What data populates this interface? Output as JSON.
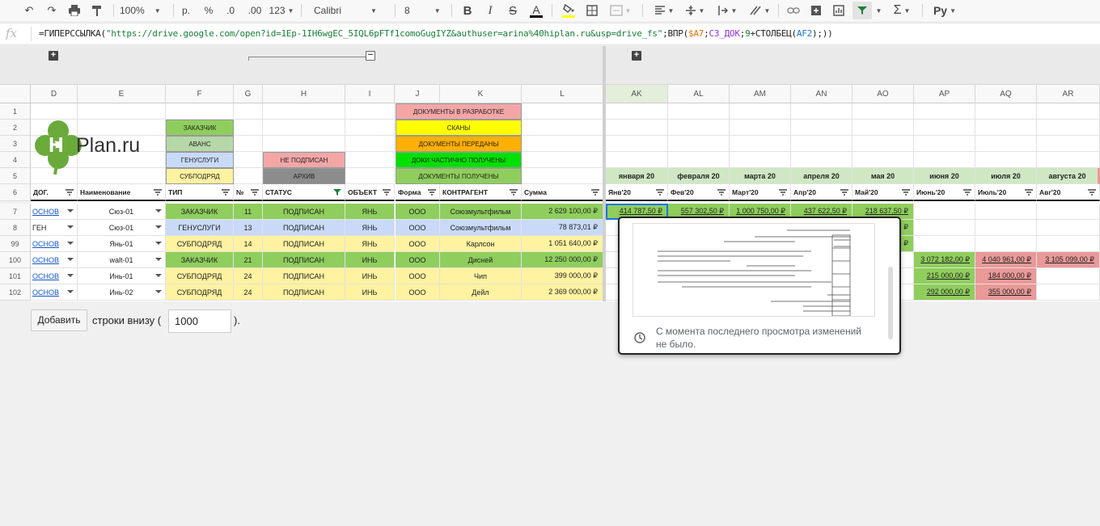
{
  "toolbar": {
    "zoom": "100%",
    "currency_label": "р.",
    "percent_label": "%",
    "decimal_dec": ".0",
    "decimal_inc": ".00",
    "format_more": "123",
    "font_name": "Calibri",
    "font_size": "8",
    "script_label": "Ру"
  },
  "formula": {
    "fx": "fx",
    "prefix": "=ГИПЕРССЫЛКА(",
    "url": "\"https://drive.google.com/open?id=1Ep-1IH6wgEC_5IQL6pFTf1comoGugIYZ&authuser=arina%40hiplan.ru&usp=drive_fs\"",
    "mid1": ";ВПР(",
    "ref1": "$A7",
    "sep1": ";",
    "ref2": "СЗ_ДОК",
    "sep2": ";",
    "num": "9",
    "mid2": "+СТОЛБЕЦ(",
    "ref3": "AF2",
    "suffix": ");))"
  },
  "group": {
    "plus": "+",
    "minus": "−"
  },
  "columns": [
    "D",
    "E",
    "F",
    "G",
    "H",
    "I",
    "J",
    "K",
    "L",
    "AK",
    "AL",
    "AM",
    "AN",
    "AO",
    "AP",
    "AQ",
    "AR"
  ],
  "rows": [
    "1",
    "2",
    "3",
    "4",
    "5",
    "6",
    "7",
    "8",
    "99",
    "100",
    "101",
    "102"
  ],
  "logo": {
    "h": "H",
    "rest": "Plan.ru"
  },
  "legend_f": [
    "ЗАКАЗЧИК",
    "АВАНС",
    "ГЕНУСЛУГИ",
    "СУБПОДРЯД"
  ],
  "legend_h": [
    "НЕ ПОДПИСАН",
    "АРХИВ"
  ],
  "legend_jk": [
    "ДОКУМЕНТЫ В РАЗРАБОТКЕ",
    "СКАНЫ",
    "ДОКУМЕНТЫ ПЕРЕДАНЫ",
    "ДОКИ ЧАСТИЧНО ПОЛУЧЕНЫ",
    "ДОКУМЕНТЫ ПОЛУЧЕНЫ"
  ],
  "months_top": [
    "января 20",
    "февраля 20",
    "марта 20",
    "апреля 20",
    "мая 20",
    "июня 20",
    "июля 20",
    "августа 20"
  ],
  "headers": [
    "ДОГ.",
    "Наименование",
    "ТИП",
    "№",
    "СТАТУС",
    "ОБЪЕКТ",
    "Форма",
    "КОНТРАГЕНТ",
    "Сумма",
    "Янв'20",
    "Фев'20",
    "Март'20",
    "Апр'20",
    "Май'20",
    "Июнь'20",
    "Июль'20",
    "Авг'20"
  ],
  "data_rows": [
    {
      "dog": "ОСНОВ",
      "name": "Сюз-01",
      "type": "ЗАКАЗЧИК",
      "num": "11",
      "status": "ПОДПИСАН",
      "obj": "ЯНЬ",
      "form": "ООО",
      "agent": "Союзмультфильм",
      "sum": "2 629 100,00 ₽",
      "m": [
        "414 787,50 ₽",
        "557 302,50 ₽",
        "1 000 750,00 ₽",
        "437 622,50 ₽",
        "218 637,50 ₽",
        "",
        "",
        ""
      ]
    },
    {
      "dog": "ГЕН",
      "name": "Сюз-01",
      "type": "ГЕНУСЛУГИ",
      "num": "13",
      "status": "ПОДПИСАН",
      "obj": "ЯНЬ",
      "form": "ООО",
      "agent": "Союзмультфильм",
      "sum": "78 873,01 ₽",
      "m": [
        "",
        "",
        "",
        "",
        "₽",
        "",
        "",
        ""
      ]
    },
    {
      "dog": "ОСНОВ",
      "name": "Янь-01",
      "type": "СУБПОДРЯД",
      "num": "14",
      "status": "ПОДПИСАН",
      "obj": "ЯНЬ",
      "form": "ООО",
      "agent": "Карлсон",
      "sum": "1 051 640,00 ₽",
      "m": [
        "",
        "",
        "",
        "",
        "₽",
        "",
        "",
        ""
      ]
    },
    {
      "dog": "ОСНОВ",
      "name": "walt-01",
      "type": "ЗАКАЗЧИК",
      "num": "21",
      "status": "ПОДПИСАН",
      "obj": "ИНЬ",
      "form": "ООО",
      "agent": "Дисней",
      "sum": "12 250 000,00 ₽",
      "m": [
        "",
        "",
        "",
        "",
        "",
        "3 072 182,00 ₽",
        "4 040 961,00 ₽",
        "3 105 099,00 ₽"
      ]
    },
    {
      "dog": "ОСНОВ",
      "name": "Инь-01",
      "type": "СУБПОДРЯД",
      "num": "24",
      "status": "ПОДПИСАН",
      "obj": "ИНЬ",
      "form": "ООО",
      "agent": "Чип",
      "sum": "399 000,00 ₽",
      "m": [
        "",
        "",
        "",
        "",
        "",
        "215 000,00 ₽",
        "184 000,00 ₽",
        ""
      ]
    },
    {
      "dog": "ОСНОВ",
      "name": "Инь-02",
      "type": "СУБПОДРЯД",
      "num": "24",
      "status": "ПОДПИСАН",
      "obj": "ИНЬ",
      "form": "ООО",
      "agent": "Дейл",
      "sum": "2 369 000,00 ₽",
      "m": [
        "",
        "",
        "",
        "",
        "",
        "292 000,00 ₽",
        "355 000,00 ₽",
        ""
      ]
    }
  ],
  "add_rows": {
    "button": "Добавить",
    "text": "строки внизу (",
    "value": "1000",
    "close": ")."
  },
  "popup": {
    "message_1": "С момента последнего просмотра изменений",
    "message_2": "не было."
  },
  "colors": {
    "green": "#8fce5c",
    "light_yellow": "#fff2a0",
    "salmon": "#ea9999",
    "accent": "#1a73e8"
  }
}
